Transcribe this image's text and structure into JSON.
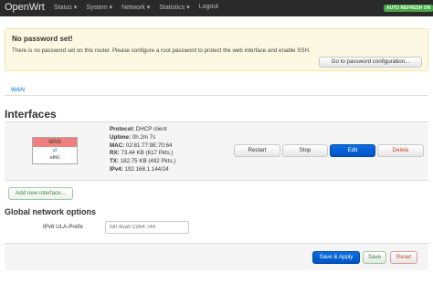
{
  "header": {
    "brand": "OpenWrt",
    "menu": [
      "Status ▾",
      "System ▾",
      "Network ▾",
      "Statistics ▾",
      "Logout"
    ],
    "auto_refresh": "AUTO REFRESH ON"
  },
  "alert": {
    "title": "No password set!",
    "text": "There is no password set on this router. Please configure a root password to protect the web interface and enable SSH.",
    "button": "Go to password configuration..."
  },
  "tabs": {
    "wan": "WAN"
  },
  "interfaces": {
    "title": "Interfaces",
    "wan": {
      "name": "WAN",
      "icon": "network-icon",
      "device": "eth0",
      "protocol_label": "Protocol:",
      "protocol": "DHCP client",
      "uptime_label": "Uptime:",
      "uptime": "0h 2m 7s",
      "mac_label": "MAC:",
      "mac": "02:81:77:9E:70:64",
      "rx_label": "RX:",
      "rx": "73.44 KB (617 Pkts.)",
      "tx_label": "TX:",
      "tx": "182.75 KB (492 Pkts.)",
      "ipv4_label": "IPv4:",
      "ipv4": "192.168.1.144/24"
    },
    "buttons": {
      "restart": "Restart",
      "stop": "Stop",
      "edit": "Edit",
      "delete": "Delete"
    },
    "add": "Add new interface..."
  },
  "global": {
    "title": "Global network options",
    "ula_label": "IPv6 ULA-Prefix",
    "ula_value": "fd0:45a0:1964::/48"
  },
  "footer": {
    "apply": "Save & Apply",
    "save": "Save",
    "reset": "Reset"
  }
}
